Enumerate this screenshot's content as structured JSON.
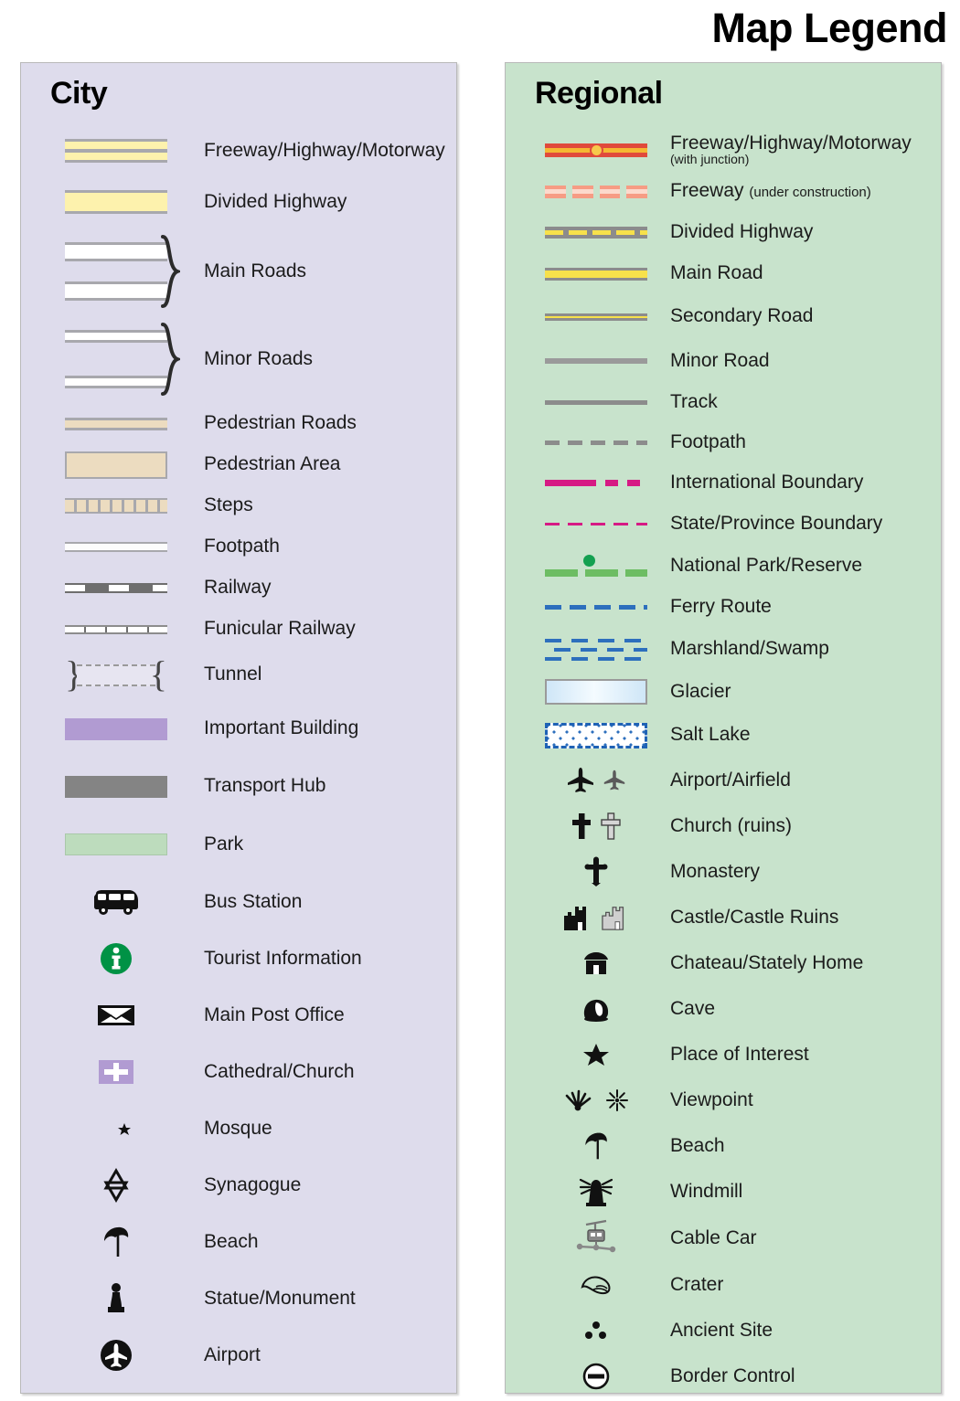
{
  "title": "Map Legend",
  "colors": {
    "city_panel_bg": "#DEDCEC",
    "regional_panel_bg": "#C8E3CC",
    "panel_border": "#B9B9B9",
    "road_casing_gray": "#A8A8AD",
    "freeway_yellow": "#FDF2AD",
    "pedestrian_tan": "#ECDCC0",
    "important_building_purple": "#B19BD2",
    "transport_hub_gray": "#848484",
    "park_green": "#BDDCBD",
    "tourist_info_green": "#009245",
    "regional_freeway_red": "#E04A3C",
    "regional_freeway_core": "#F5B733",
    "regional_uc_salmon": "#F69C84",
    "regional_road_yellow": "#F7E14B",
    "regional_casing_gray": "#8C8C8C",
    "boundary_magenta": "#D61A84",
    "national_park_green": "#6DBD63",
    "national_park_dot": "#13A050",
    "water_blue": "#2D6FBD",
    "glacier_blue": "#CFE6F7",
    "text_black": "#1B1B1B"
  },
  "city": {
    "heading": "City",
    "items": [
      {
        "id": "freeway",
        "label": "Freeway/Highway/Motorway",
        "symbol": "double-yellow-band"
      },
      {
        "id": "divided-highway",
        "label": "Divided Highway",
        "symbol": "single-yellow-band"
      },
      {
        "id": "main-roads",
        "label": "Main Roads",
        "symbol": "white-band-pair-braced"
      },
      {
        "id": "minor-roads",
        "label": "Minor Roads",
        "symbol": "thin-white-band-pair-braced"
      },
      {
        "id": "pedestrian-roads",
        "label": "Pedestrian Roads",
        "symbol": "tan-thin-band"
      },
      {
        "id": "pedestrian-area",
        "label": "Pedestrian Area",
        "symbol": "tan-filled-block"
      },
      {
        "id": "steps",
        "label": "Steps",
        "symbol": "tan-hatched-band"
      },
      {
        "id": "footpath",
        "label": "Footpath",
        "symbol": "thin-white-line"
      },
      {
        "id": "railway",
        "label": "Railway",
        "symbol": "black-white-dashed-line"
      },
      {
        "id": "funicular-railway",
        "label": "Funicular Railway",
        "symbol": "ticked-line"
      },
      {
        "id": "tunnel",
        "label": "Tunnel",
        "symbol": "bracketed-dashed-tube"
      },
      {
        "id": "important-building",
        "label": "Important Building",
        "symbol": "purple-block"
      },
      {
        "id": "transport-hub",
        "label": "Transport Hub",
        "symbol": "gray-block"
      },
      {
        "id": "park",
        "label": "Park",
        "symbol": "green-block"
      },
      {
        "id": "bus-station",
        "label": "Bus Station",
        "symbol": "bus-icon"
      },
      {
        "id": "tourist-information",
        "label": "Tourist Information",
        "symbol": "info-circle-icon"
      },
      {
        "id": "main-post-office",
        "label": "Main Post Office",
        "symbol": "envelope-icon"
      },
      {
        "id": "cathedral-church",
        "label": "Cathedral/Church",
        "symbol": "cross-on-purple-icon"
      },
      {
        "id": "mosque",
        "label": "Mosque",
        "symbol": "crescent-star-icon"
      },
      {
        "id": "synagogue",
        "label": "Synagogue",
        "symbol": "star-of-david-icon"
      },
      {
        "id": "beach",
        "label": "Beach",
        "symbol": "parasol-icon"
      },
      {
        "id": "statue-monument",
        "label": "Statue/Monument",
        "symbol": "statue-icon"
      },
      {
        "id": "airport",
        "label": "Airport",
        "symbol": "airplane-circle-icon"
      }
    ]
  },
  "regional": {
    "heading": "Regional",
    "items": [
      {
        "id": "freeway-junction",
        "label": "Freeway/Highway/Motorway",
        "sublabel": "(with junction)",
        "symbol": "red-band-with-junction-dot"
      },
      {
        "id": "freeway-construction",
        "label": "Freeway ",
        "sublabel_inline": "(under construction)",
        "symbol": "dashed-salmon-band"
      },
      {
        "id": "divided-highway",
        "label": "Divided Highway",
        "symbol": "gray-band-dashed-yellow-core"
      },
      {
        "id": "main-road",
        "label": "Main Road",
        "symbol": "thick-yellow-band"
      },
      {
        "id": "secondary-road",
        "label": "Secondary Road",
        "symbol": "thin-yellow-band"
      },
      {
        "id": "minor-road",
        "label": "Minor Road",
        "symbol": "white-cased-line"
      },
      {
        "id": "track",
        "label": "Track",
        "symbol": "solid-gray-line"
      },
      {
        "id": "footpath",
        "label": "Footpath",
        "symbol": "dashed-gray-line"
      },
      {
        "id": "international-boundary",
        "label": "International Boundary",
        "symbol": "magenta-dash-dot-line"
      },
      {
        "id": "state-province-boundary",
        "label": "State/Province Boundary",
        "symbol": "thin-magenta-dashed-line"
      },
      {
        "id": "national-park-reserve",
        "label": "National Park/Reserve",
        "symbol": "green-dashed-line-with-dot"
      },
      {
        "id": "ferry-route",
        "label": "Ferry Route",
        "symbol": "blue-dashed-line"
      },
      {
        "id": "marshland-swamp",
        "label": "Marshland/Swamp",
        "symbol": "blue-dash-rows"
      },
      {
        "id": "glacier",
        "label": "Glacier",
        "symbol": "pale-blue-gradient-block"
      },
      {
        "id": "salt-lake",
        "label": "Salt Lake",
        "symbol": "blue-dotted-block"
      },
      {
        "id": "airport-airfield",
        "label": "Airport/Airfield",
        "symbol": "two-airplane-icons"
      },
      {
        "id": "church-ruins",
        "label": "Church (ruins)",
        "symbol": "two-cross-icons"
      },
      {
        "id": "monastery",
        "label": "Monastery",
        "symbol": "ornate-cross-icon"
      },
      {
        "id": "castle-castle-ruins",
        "label": "Castle/Castle Ruins",
        "symbol": "two-castle-icons"
      },
      {
        "id": "chateau-stately-home",
        "label": "Chateau/Stately Home",
        "symbol": "mansion-icon"
      },
      {
        "id": "cave",
        "label": "Cave",
        "symbol": "cave-icon"
      },
      {
        "id": "place-of-interest",
        "label": "Place of Interest",
        "symbol": "star-icon"
      },
      {
        "id": "viewpoint",
        "label": "Viewpoint",
        "symbol": "two-viewpoint-icons"
      },
      {
        "id": "beach",
        "label": "Beach",
        "symbol": "parasol-icon"
      },
      {
        "id": "windmill",
        "label": "Windmill",
        "symbol": "windmill-icon"
      },
      {
        "id": "cable-car",
        "label": "Cable Car",
        "symbol": "cable-car-icon"
      },
      {
        "id": "crater",
        "label": "Crater",
        "symbol": "crater-icon"
      },
      {
        "id": "ancient-site",
        "label": "Ancient Site",
        "symbol": "three-dots-icon"
      },
      {
        "id": "border-control",
        "label": "Border Control",
        "symbol": "minus-circle-icon"
      }
    ]
  }
}
